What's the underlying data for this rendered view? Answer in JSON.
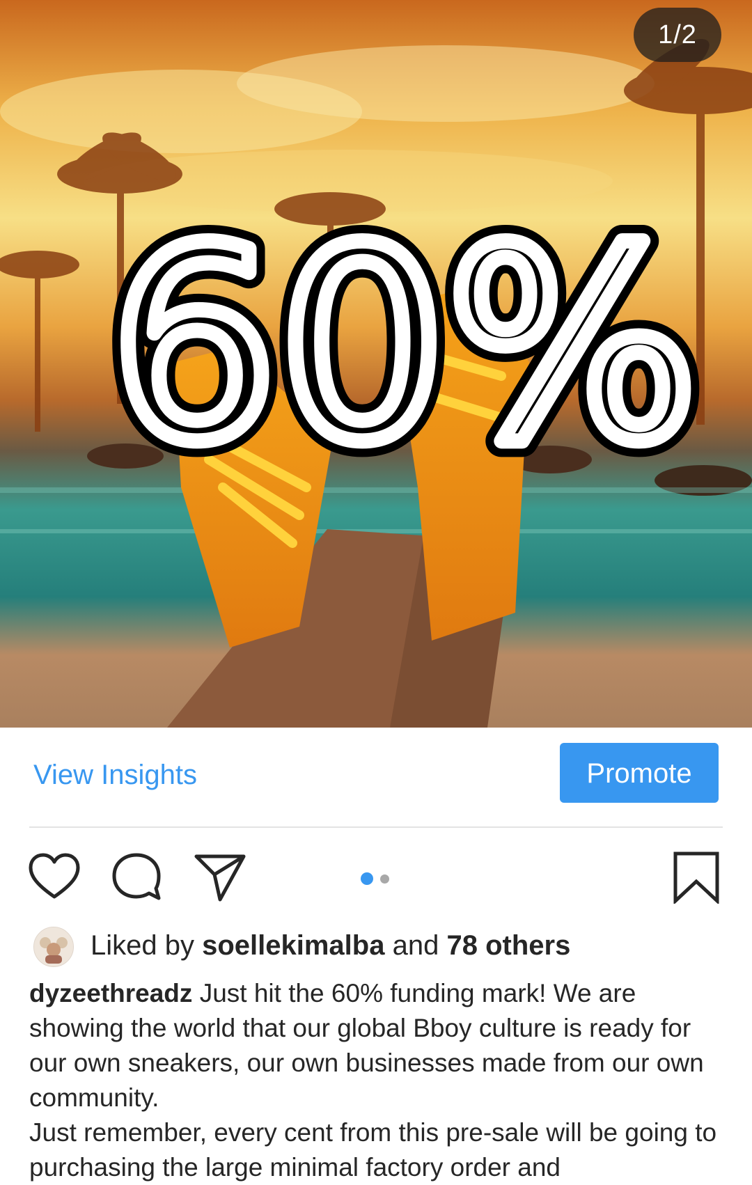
{
  "post": {
    "image_alt_text": "60%",
    "counter": "1/2",
    "current_slide": 1,
    "total_slides": 2
  },
  "insights": {
    "view_label": "View Insights",
    "promote_label": "Promote"
  },
  "actions": {
    "like_icon": "heart-icon",
    "comment_icon": "comment-icon",
    "share_icon": "paper-plane-icon",
    "save_icon": "bookmark-icon"
  },
  "likes": {
    "prefix": "Liked by",
    "user": "soellekimalba",
    "middle": "and",
    "others": "78 others"
  },
  "caption": {
    "username": "dyzeethreadz",
    "line1": "Just hit the 60% funding mark! We are showing the world that our global Bboy culture is ready for our own sneakers, our own businesses made from our own community.",
    "line2": "Just remember, every cent from this pre-sale will be going to purchasing the large minimal factory order and"
  },
  "colors": {
    "accent": "#3897f0",
    "text": "#262626",
    "divider": "#e3e3e3"
  }
}
